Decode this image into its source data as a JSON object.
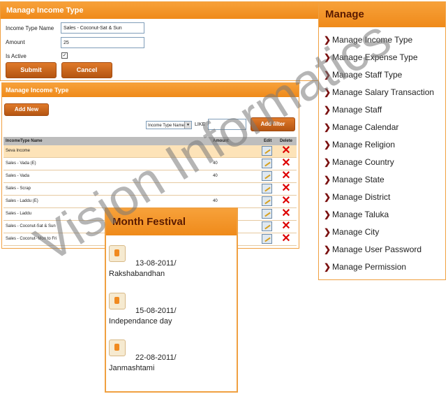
{
  "form": {
    "title": "Manage Income Type",
    "income_type_label": "Income Type Name",
    "income_type_value": "Sales - Coconut-Sat & Sun",
    "amount_label": "Amount",
    "amount_value": "25",
    "is_active_label": "Is Active",
    "is_active_checked": true,
    "submit_label": "Submit",
    "cancel_label": "Cancel"
  },
  "list": {
    "title": "Manage Income Type",
    "add_new_label": "Add New",
    "filter_select_value": "Income Type Name",
    "like_label": "LIKE",
    "add_filter_label": "Add filter",
    "columns": {
      "name": "IncomeType Name",
      "amount": "Amount",
      "edit": "Edit",
      "delete": "Delete"
    },
    "rows": [
      {
        "name": "Seva Income",
        "amount": ""
      },
      {
        "name": "Sales - Vada (E)",
        "amount": "40"
      },
      {
        "name": "Sales - Vada",
        "amount": "40"
      },
      {
        "name": "Sales - Scrap",
        "amount": ""
      },
      {
        "name": "Sales - Laddu (E)",
        "amount": "40"
      },
      {
        "name": "Sales - Laddu",
        "amount": ""
      },
      {
        "name": "Sales - Coconut-Sat & Sun",
        "amount": ""
      },
      {
        "name": "Sales - Coconut- Mon to Fri",
        "amount": ""
      }
    ]
  },
  "manage": {
    "title": "Manage",
    "items": [
      "Manage Income Type",
      "Manage Expense Type",
      "Manage Staff Type",
      "Manage Salary Transaction",
      "Manage Staff",
      "Manage Calendar",
      "Manage Religion",
      "Manage Country",
      "Manage State",
      "Manage District",
      "Manage Taluka",
      "Manage City",
      "Manage User Password",
      "Manage Permission"
    ]
  },
  "festival": {
    "title": "Month Festival",
    "items": [
      {
        "date": "13-08-2011/",
        "name": "Rakshabandhan"
      },
      {
        "date": "15-08-2011/",
        "name": "Independance day"
      },
      {
        "date": "22-08-2011/",
        "name": "Janmashtami"
      }
    ]
  },
  "watermark": "Vision Informatics",
  "colors": {
    "accent": "#ef8a1a",
    "button": "#c86018",
    "highlight_row": "#fde3b8"
  }
}
